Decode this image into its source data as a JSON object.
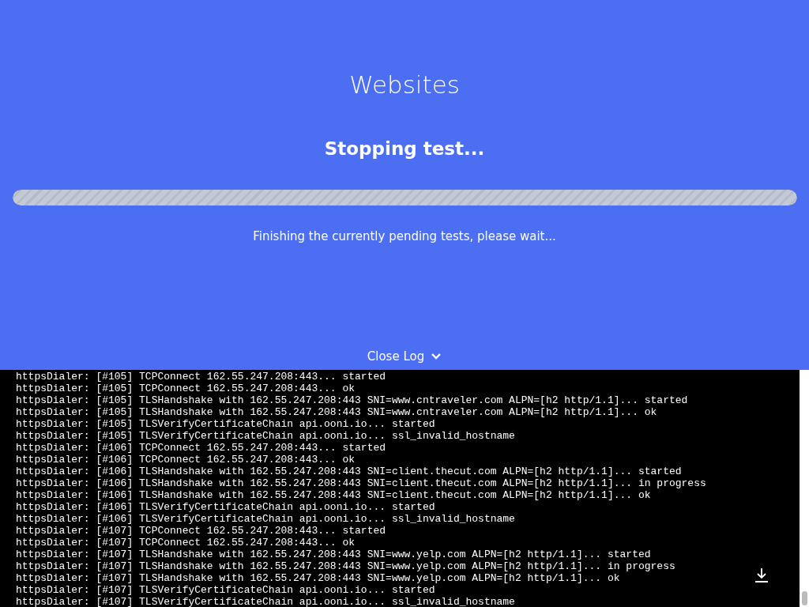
{
  "header": {
    "title": "Websites",
    "status": "Stopping test...",
    "message": "Finishing the currently pending tests, please wait...",
    "toggle_label": "Close Log",
    "progress": {
      "level": 1
    }
  },
  "log": [
    "httpsDialer: [#105] TCPConnect 162.55.247.208:443... started",
    "httpsDialer: [#105] TCPConnect 162.55.247.208:443... ok",
    "httpsDialer: [#105] TLSHandshake with 162.55.247.208:443 SNI=www.cntraveler.com ALPN=[h2 http/1.1]... started",
    "httpsDialer: [#105] TLSHandshake with 162.55.247.208:443 SNI=www.cntraveler.com ALPN=[h2 http/1.1]... ok",
    "httpsDialer: [#105] TLSVerifyCertificateChain api.ooni.io... started",
    "httpsDialer: [#105] TLSVerifyCertificateChain api.ooni.io... ssl_invalid_hostname",
    "httpsDialer: [#106] TCPConnect 162.55.247.208:443... started",
    "httpsDialer: [#106] TCPConnect 162.55.247.208:443... ok",
    "httpsDialer: [#106] TLSHandshake with 162.55.247.208:443 SNI=client.thecut.com ALPN=[h2 http/1.1]... started",
    "httpsDialer: [#106] TLSHandshake with 162.55.247.208:443 SNI=client.thecut.com ALPN=[h2 http/1.1]... in progress",
    "httpsDialer: [#106] TLSHandshake with 162.55.247.208:443 SNI=client.thecut.com ALPN=[h2 http/1.1]... ok",
    "httpsDialer: [#106] TLSVerifyCertificateChain api.ooni.io... started",
    "httpsDialer: [#106] TLSVerifyCertificateChain api.ooni.io... ssl_invalid_hostname",
    "httpsDialer: [#107] TCPConnect 162.55.247.208:443... started",
    "httpsDialer: [#107] TCPConnect 162.55.247.208:443... ok",
    "httpsDialer: [#107] TLSHandshake with 162.55.247.208:443 SNI=www.yelp.com ALPN=[h2 http/1.1]... started",
    "httpsDialer: [#107] TLSHandshake with 162.55.247.208:443 SNI=www.yelp.com ALPN=[h2 http/1.1]... in progress",
    "httpsDialer: [#107] TLSHandshake with 162.55.247.208:443 SNI=www.yelp.com ALPN=[h2 http/1.1]... ok",
    "httpsDialer: [#107] TLSVerifyCertificateChain api.ooni.io... started",
    "httpsDialer: [#107] TLSVerifyCertificateChain api.ooni.io... ssl_invalid_hostname"
  ]
}
